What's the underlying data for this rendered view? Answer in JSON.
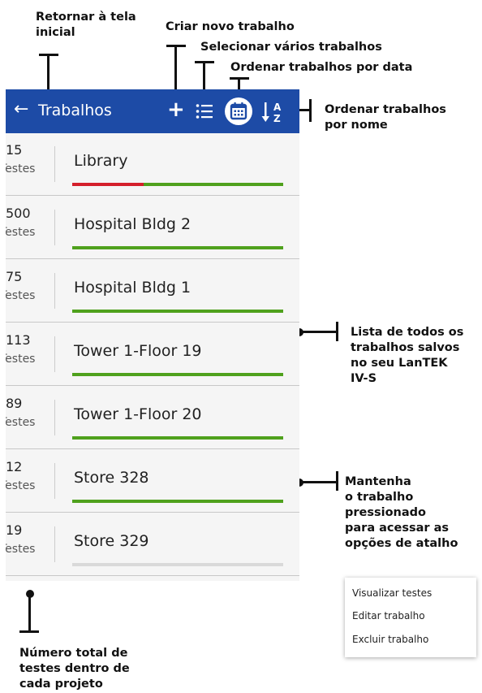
{
  "annotations": {
    "return_home": [
      "Retornar à tela",
      "inicial"
    ],
    "new_job": "Criar novo trabalho",
    "select_multi": "Selecionar vários trabalhos",
    "sort_date": "Ordenar trabalhos por data",
    "sort_name": [
      "Ordenar trabalhos",
      "por nome"
    ],
    "job_list": [
      "Lista de todos os",
      "trabalhos salvos",
      "no seu LanTEK",
      "IV-S"
    ],
    "long_press": [
      "Mantenha",
      "o trabalho",
      "pressionado",
      "para acessar as",
      "opções de atalho"
    ],
    "total_tests": [
      "Número total de",
      "testes dentro de",
      "cada projeto"
    ]
  },
  "appbar": {
    "back_icon": "arrow-left-icon",
    "title": "Trabalhos",
    "add_icon": "plus-icon",
    "select_icon": "list-icon",
    "sort_date_icon": "calendar-icon",
    "sort_name_icon": "sort-alpha-icon",
    "color": "#1d4ba6"
  },
  "jobs": [
    {
      "count": "15",
      "count_label": "Testes",
      "name": "Library",
      "fail_fraction": 0.34,
      "pass_fraction": 0.66
    },
    {
      "count": "500",
      "count_label": "Testes",
      "name": "Hospital Bldg 2",
      "fail_fraction": 0,
      "pass_fraction": 1
    },
    {
      "count": "75",
      "count_label": "Testes",
      "name": "Hospital Bldg 1",
      "fail_fraction": 0,
      "pass_fraction": 1
    },
    {
      "count": "113",
      "count_label": "Testes",
      "name": "Tower 1-Floor 19",
      "fail_fraction": 0,
      "pass_fraction": 1
    },
    {
      "count": "89",
      "count_label": "Testes",
      "name": "Tower 1-Floor 20",
      "fail_fraction": 0,
      "pass_fraction": 1
    },
    {
      "count": "12",
      "count_label": "Testes",
      "name": "Store 328",
      "fail_fraction": 0,
      "pass_fraction": 1
    },
    {
      "count": "19",
      "count_label": "Testes",
      "name": "Store 329",
      "fail_fraction": 0,
      "pass_fraction": 0
    }
  ],
  "status_colors": {
    "pass": "#4fa11d",
    "fail": "#d41f2b",
    "empty": "#d9d9d9"
  },
  "context_menu": {
    "items": [
      "Visualizar testes",
      "Editar trabalho",
      "Excluir trabalho"
    ]
  }
}
